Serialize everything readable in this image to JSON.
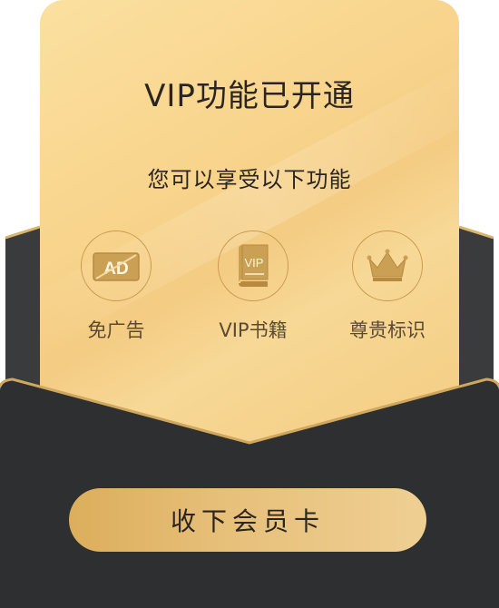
{
  "dialog": {
    "title": "VIP功能已开通",
    "subtitle": "您可以享受以下功能",
    "features": [
      {
        "label": "免广告",
        "icon": "ad-free-icon",
        "icon_text": "AD"
      },
      {
        "label": "VIP书籍",
        "icon": "vip-book-icon",
        "icon_text": "VIP"
      },
      {
        "label": "尊贵标识",
        "icon": "crown-icon"
      }
    ],
    "accept_button_label": "收下会员卡"
  },
  "colors": {
    "card_gold": "#f6d18c",
    "envelope_dark": "#2e2f31",
    "button_gold": "#e3b96d",
    "text_dark": "#2a2520",
    "label_brown": "#5b4a33",
    "icon_gold": "#c99a4e"
  }
}
